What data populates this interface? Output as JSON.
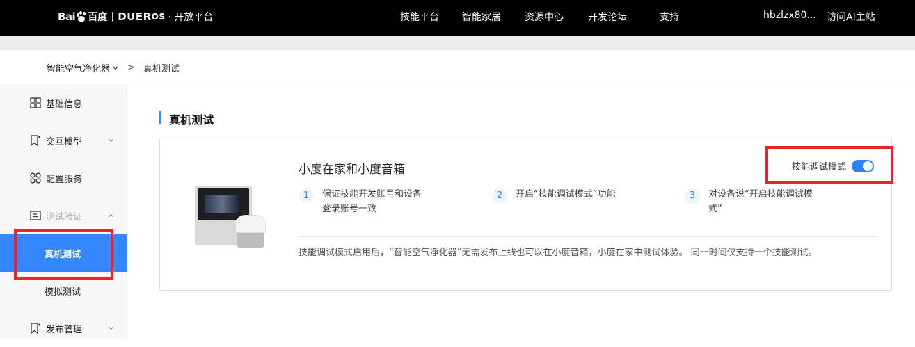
{
  "header": {
    "logo_baidu": "Bai",
    "logo_baidu_cn": "百度",
    "logo_dueros": "DUER",
    "logo_dueros_os": "OS",
    "logo_platform": "· 开放平台",
    "nav": [
      "技能平台",
      "智能家居",
      "资源中心",
      "开发论坛",
      "支持"
    ],
    "username": "hbzlzx80...",
    "visit_ai": "访问AI主站"
  },
  "breadcrumb": {
    "project": "智能空气净化器",
    "separator": ">",
    "current": "真机测试"
  },
  "sidebar": {
    "items": [
      {
        "label": "基础信息",
        "icon": "grid-icon",
        "expandable": false
      },
      {
        "label": "交互模型",
        "icon": "bookmark-icon",
        "expandable": true
      },
      {
        "label": "配置服务",
        "icon": "services-icon",
        "expandable": false
      },
      {
        "label": "测试验证",
        "icon": "test-icon",
        "expandable": true,
        "expanded": true
      },
      {
        "label": "真机测试",
        "sub": true,
        "active": true
      },
      {
        "label": "模拟测试",
        "sub": true
      },
      {
        "label": "发布管理",
        "icon": "bookmark-icon",
        "expandable": true
      }
    ]
  },
  "main": {
    "section_title": "真机测试",
    "card": {
      "title": "小度在家和小度音箱",
      "toggle_label": "技能调试模式",
      "toggle_on": true,
      "steps": [
        {
          "num": "1",
          "line1": "保证技能开发账号和设备",
          "line2": "登录账号一致"
        },
        {
          "num": "2",
          "line1": "开启“技能调试模式”功能",
          "line2": ""
        },
        {
          "num": "3",
          "line1": "对设备说“开启技能调试模",
          "line2": "式”"
        }
      ],
      "note": "技能调试模式启用后，“智能空气净化器”无需发布上线也可以在小度音箱，小度在家中测试体验。 同一时间仅支持一个技能测试。"
    }
  },
  "colors": {
    "accent": "#3388ff",
    "highlight_box": "#e6262e",
    "topbar": "#000000"
  }
}
